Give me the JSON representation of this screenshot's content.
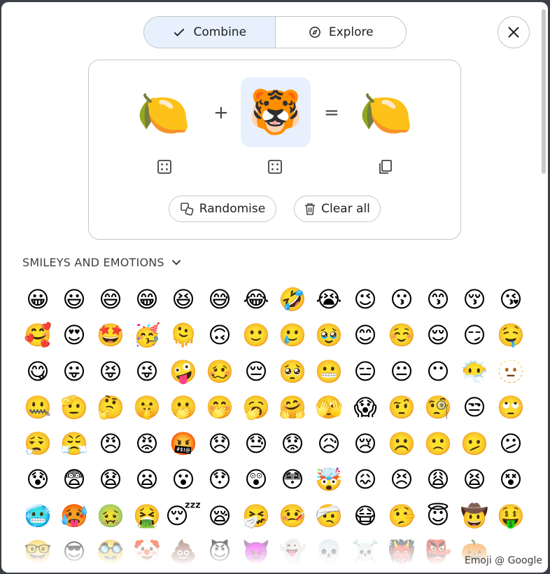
{
  "tabs": [
    {
      "label": "Combine",
      "icon": "check-icon",
      "active": true
    },
    {
      "label": "Explore",
      "icon": "compass-icon",
      "active": false
    }
  ],
  "close_icon": "close-icon",
  "combiner": {
    "left": "🍋",
    "plus": "+",
    "right": "🐯",
    "equals": "=",
    "result": "🍋",
    "randomise_label": "Randomise",
    "clear_label": "Clear all"
  },
  "section": {
    "title": "SMILEYS AND EMOTIONS"
  },
  "emojis": [
    "😀",
    "😃",
    "😄",
    "😁",
    "😆",
    "😅",
    "😂",
    "🤣",
    "😭",
    "😉",
    "😗",
    "😙",
    "😚",
    "😘",
    "🥰",
    "😍",
    "🤩",
    "🥳",
    "🫠",
    "🙃",
    "🙂",
    "🥲",
    "🥹",
    "😊",
    "☺️",
    "😌",
    "😏",
    "🤤",
    "😋",
    "😛",
    "😝",
    "😜",
    "🤪",
    "🥴",
    "😔",
    "🥺",
    "😬",
    "😑",
    "😐",
    "😶",
    "😶‍🌫️",
    "🫥",
    "🤐",
    "🫡",
    "🤔",
    "🤫",
    "🫢",
    "🤭",
    "🥱",
    "🤗",
    "🫣",
    "😱",
    "🤨",
    "🧐",
    "😒",
    "🙄",
    "😮‍💨",
    "😤",
    "😠",
    "😡",
    "🤬",
    "😞",
    "😓",
    "😟",
    "😥",
    "😢",
    "☹️",
    "🙁",
    "🫤",
    "😕",
    "😰",
    "😨",
    "😧",
    "😦",
    "😮",
    "😯",
    "😲",
    "😳",
    "🤯",
    "😖",
    "😣",
    "😩",
    "😫",
    "😵",
    "🥶",
    "🥵",
    "🤢",
    "🤮",
    "😴",
    "😪",
    "🤧",
    "🤒",
    "🤕",
    "😷",
    "🤥",
    "😇",
    "🤠",
    "🤑",
    "🤓",
    "😎",
    "🥸",
    "🤡",
    "💩",
    "😈",
    "👿",
    "👻",
    "💀",
    "☠️",
    "👹",
    "👺",
    "🎃"
  ],
  "credit": "Emoji @ Google",
  "colors": {
    "accent_bg": "#e8f0fe",
    "border": "#c4c7c5"
  }
}
